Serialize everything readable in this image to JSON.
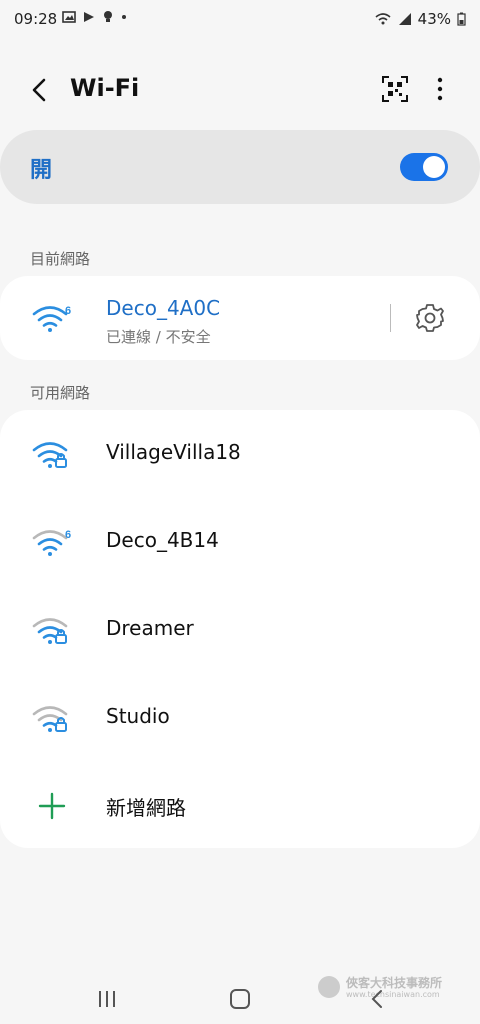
{
  "status_bar": {
    "time": "09:28",
    "battery": "43%"
  },
  "header": {
    "title": "Wi-Fi"
  },
  "wifi_toggle": {
    "label": "開",
    "state": "on",
    "accent_color": "#1a73e8"
  },
  "current_network": {
    "section_label": "目前網路",
    "name": "Deco_4A0C",
    "status": "已連線 / 不安全",
    "icon": "wifi-6-icon"
  },
  "available": {
    "section_label": "可用網路",
    "networks": [
      {
        "name": "VillageVilla18",
        "icon": "wifi-lock-icon",
        "strength": "strong"
      },
      {
        "name": "Deco_4B14",
        "icon": "wifi-6-icon",
        "strength": "medium"
      },
      {
        "name": "Dreamer",
        "icon": "wifi-lock-icon",
        "strength": "medium"
      },
      {
        "name": "Studio",
        "icon": "wifi-lock-icon",
        "strength": "weak"
      }
    ],
    "add_label": "新增網路"
  },
  "watermark": {
    "title": "俠客大科技事務所",
    "url": "www.techsinaiwan.com"
  }
}
